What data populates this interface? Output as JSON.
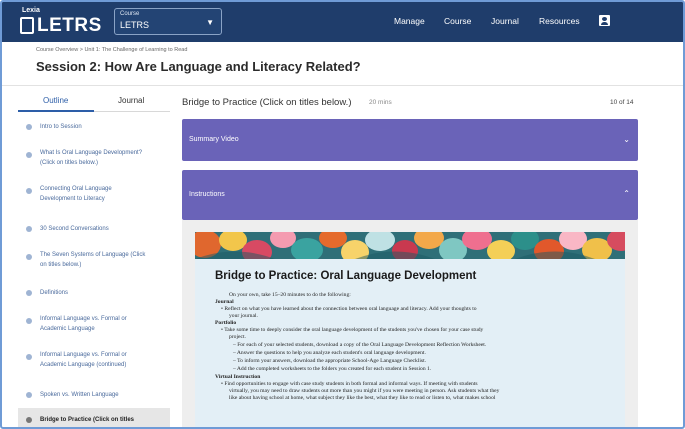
{
  "brand": {
    "small": "Lexia",
    "name": "LETRS"
  },
  "course_select": {
    "label": "Course",
    "value": "LETRS"
  },
  "nav": {
    "links": [
      "Manage",
      "Course",
      "Journal",
      "Resources"
    ]
  },
  "breadcrumb": "Course Overview  >  Unit 1: The Challenge of Learning to Read",
  "session_title": "Session 2:  How Are Language and Literacy Related?",
  "sidebar": {
    "tabs": [
      "Outline",
      "Journal"
    ],
    "items": [
      {
        "l1": "Intro to Session",
        "l2": ""
      },
      {
        "l1": "What Is Oral Language Development?",
        "l2": "(Click on titles below.)"
      },
      {
        "l1": "Connecting Oral Language",
        "l2": "Development to Literacy"
      },
      {
        "l1": "30 Second Conversations",
        "l2": ""
      },
      {
        "l1": "The Seven Systems of Language (Click",
        "l2": "on titles below.)"
      },
      {
        "l1": "Definitions",
        "l2": ""
      },
      {
        "l1": "Informal Language vs. Formal or",
        "l2": "Academic Language"
      },
      {
        "l1": "Informal Language vs. Formal or",
        "l2": "Academic Language (continued)"
      },
      {
        "l1": "Spoken vs. Written Language",
        "l2": ""
      },
      {
        "l1": "Bridge to Practice (Click on titles",
        "l2": ""
      }
    ]
  },
  "main": {
    "title": "Bridge to Practice (Click on titles below.)",
    "duration": "20 mins",
    "counter": "10 of 14",
    "accordions": [
      {
        "label": "Summary Video",
        "chevron": "⌄"
      },
      {
        "label": "Instructions",
        "chevron": "⌃"
      }
    ]
  },
  "document": {
    "title": "Bridge to Practice: Oral Language Development",
    "lines": [
      "On your own, take 15–20 minutes to do the following:",
      "Journal",
      "•  Reflect on what you have learned about the connection between oral language and literacy. Add your thoughts to",
      "your journal.",
      "Portfolio",
      "•  Take some time to deeply consider the oral language development of the students you've chosen for your case study",
      "project.",
      "– For each of your selected students, download a copy of the Oral Language Development Reflection Worksheet.",
      "– Answer the questions to help you analyze each student's oral language development.",
      "– To inform your answers, download the appropriate School-Age Language Checklist.",
      "– Add the completed worksheets to the folders you created for each student in Session 1.",
      "Virtual Instruction",
      "•  Find opportunities to engage with case study students in both formal and informal ways. If meeting with students",
      "virtually, you may need to draw students out more than you might if you were meeting in person. Ask students what they",
      "like about having school at home, what subject they like the best, what they like to read or listen to, what makes school"
    ]
  },
  "colors": {
    "nav": "#1f3d6b",
    "accordion": "#6a63b8",
    "link": "#4a6a9c",
    "doc_bg": "#e3eff6"
  }
}
